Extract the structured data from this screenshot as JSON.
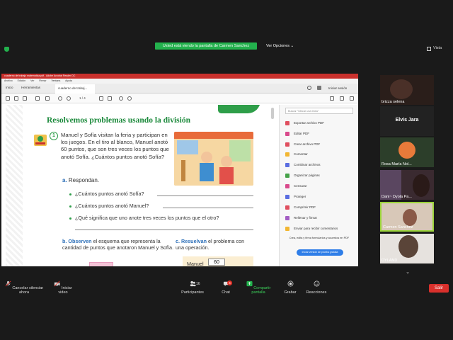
{
  "zoom": {
    "share_banner": "Usted está viendo la pantalla de Carmen Sanchez",
    "view_options": "Ver Opciones ⌄",
    "view_label": "Vista",
    "participants_count": "16",
    "chat_badge": "4"
  },
  "acrobat": {
    "window_title": "cuaderno de trabajo matematica.pdf - Adobe Acrobat Reader DC",
    "menu": [
      "Archivo",
      "Edición",
      "Ver",
      "Firmar",
      "Ventana",
      "Ayuda"
    ],
    "tabs": [
      "Inicio",
      "Herramientas",
      "cuaderno de trabaj..."
    ],
    "sign_in": "Iniciar sesión",
    "page_indicator": "1 / 4",
    "side_search_placeholder": "Buscar \"Ubicar una línea\"",
    "tools": [
      "Exportar archivo PDF",
      "Editar PDF",
      "Crear archivo PDF",
      "Comentar",
      "Combinar archivos",
      "Organizar páginas",
      "Censurar",
      "Proteger",
      "Comprimir PDF",
      "Rellenar y firmar",
      "Enviar para recibir comentarios"
    ],
    "promo_text": "Crea, edita y firma formularios y acuerdos en PDF",
    "promo_button": "Iniciar versión de prueba gratuita"
  },
  "document": {
    "title": "Resolvemos problemas usando la división",
    "number": "1",
    "problem": "Manuel y Sofía visitan la feria y participan en los juegos. En el tiro al blanco, Manuel anotó 60 puntos, que son tres veces los puntos que anotó Sofía. ¿Cuántos puntos anotó Sofía?",
    "section_a_letter": "a.",
    "section_a": "Respondan.",
    "q1": "¿Cuántos puntos anotó Sofía?",
    "q2": "¿Cuántos puntos anotó Manuel?",
    "q3": "¿Qué significa que uno anote tres veces los puntos que el otro?",
    "section_b_letter": "b.",
    "section_b_verb": "Observen",
    "section_b": "el esquema que representa la cantidad de puntos que anotaron Manuel y Sofía.",
    "section_c_letter": "c.",
    "section_c_verb": "Resuelvan",
    "section_c": "el problema con una operación.",
    "manuel_label": "Manuel",
    "manuel_value": "60"
  },
  "participants": [
    {
      "name": "brizza selena",
      "video": true
    },
    {
      "name": "Elvis Jara",
      "video": false
    },
    {
      "name": "Rosa María Nol...",
      "video": true
    },
    {
      "name": "Dani~ Dyola Pa...",
      "video": true
    },
    {
      "name": "Carmen Sanchez",
      "video": true,
      "active": true
    },
    {
      "name": "DYLAND",
      "video": true
    }
  ],
  "toolbar": {
    "mute": "Cancelar silenciar ahora",
    "video": "Iniciar video",
    "participants": "Participantes",
    "chat": "Chat",
    "share": "Compartir pantalla",
    "record": "Grabar",
    "reactions": "Reacciones",
    "leave": "Salir"
  }
}
